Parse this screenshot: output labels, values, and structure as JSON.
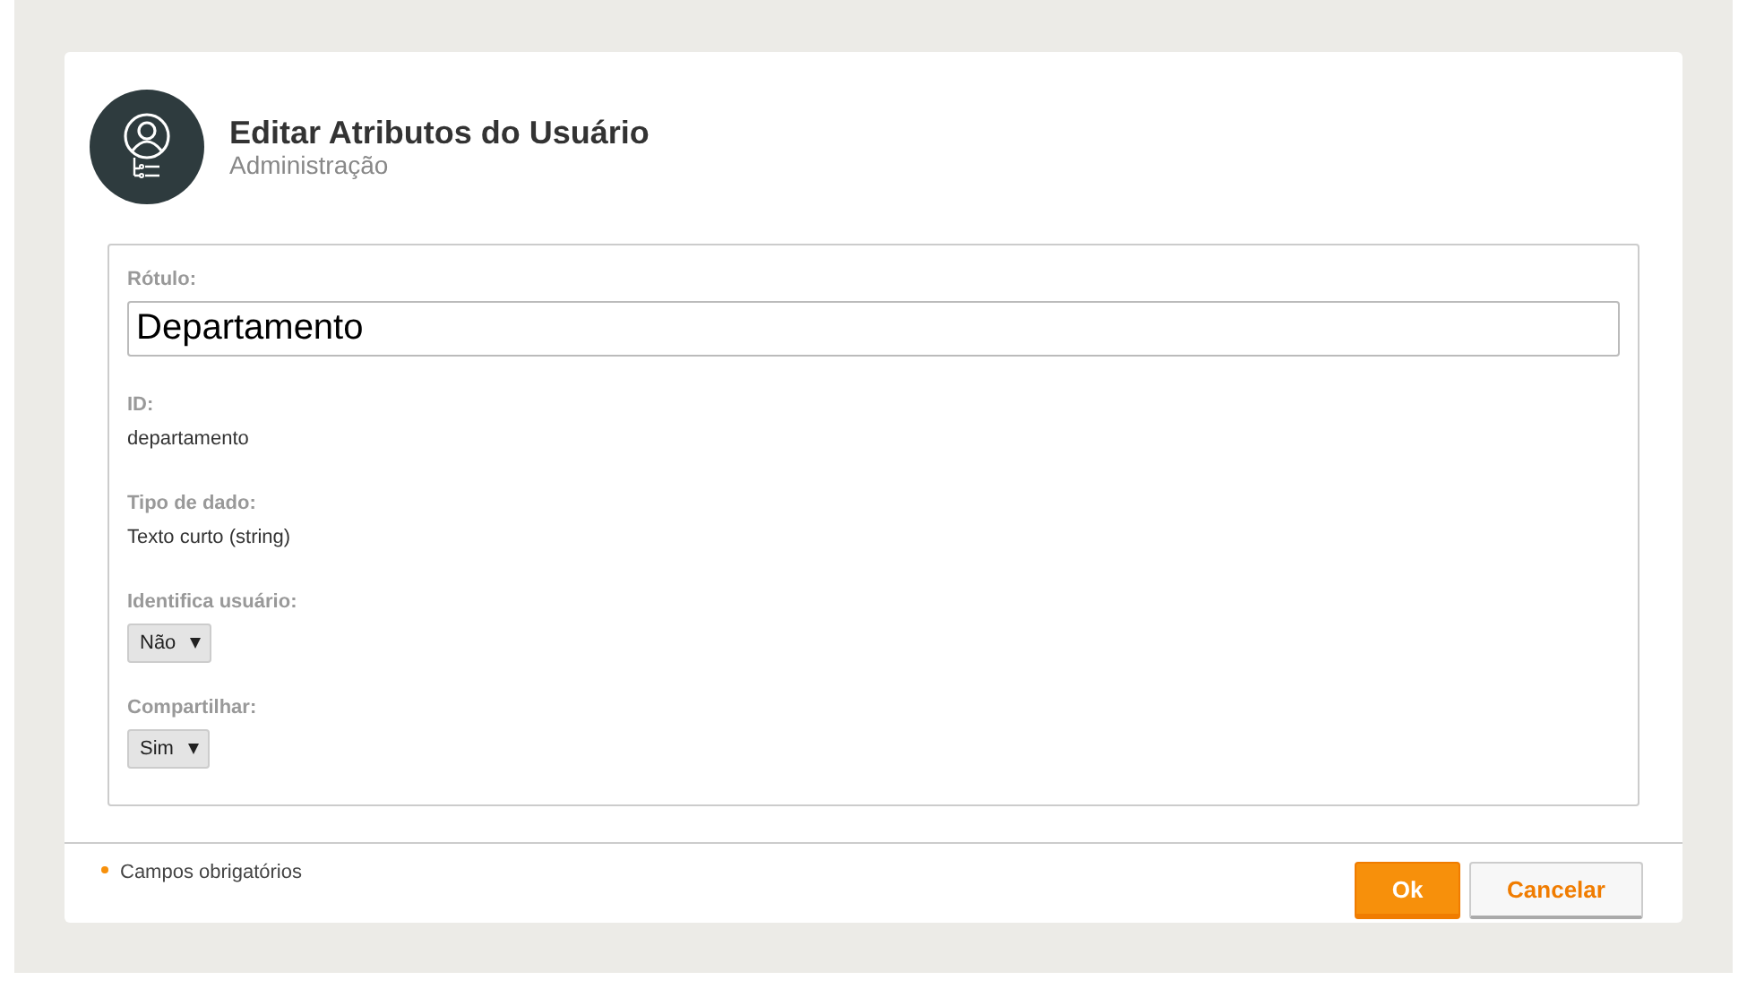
{
  "header": {
    "title": "Editar Atributos do Usuário",
    "subtitle": "Administração"
  },
  "fields": [
    {
      "kind": "input",
      "label": "Rótulo:",
      "value": "Departamento"
    },
    {
      "kind": "text",
      "label": "ID:",
      "value": "departamento"
    },
    {
      "kind": "text",
      "label": "Tipo de dado:",
      "value": "Texto curto (string)"
    },
    {
      "kind": "select",
      "label": "Identifica usuário:",
      "value": "Não"
    },
    {
      "kind": "select",
      "label": "Compartilhar:",
      "value": "Sim"
    }
  ],
  "footer": {
    "required_note": "Campos obrigatórios",
    "buttons": [
      {
        "kind": "primary",
        "label": "Ok"
      },
      {
        "kind": "secondary",
        "label": "Cancelar"
      }
    ]
  }
}
